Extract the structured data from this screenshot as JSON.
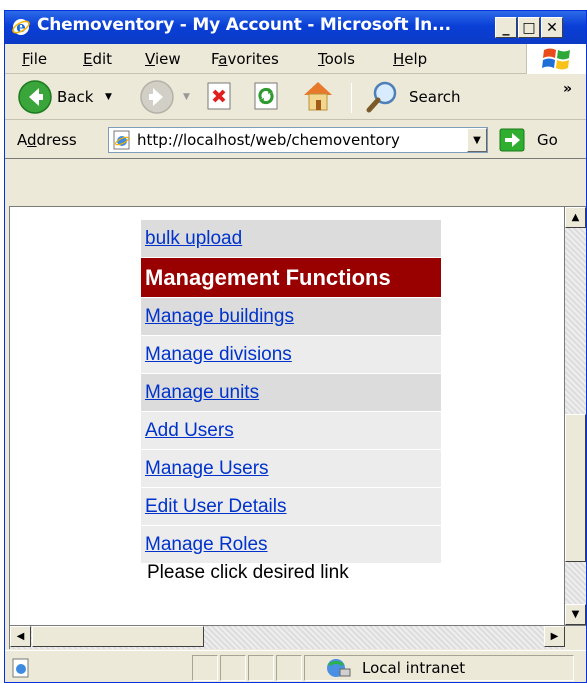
{
  "window": {
    "title": "Chemoventory - My Account - Microsoft In...",
    "minimize_label": "_",
    "maximize_label": "□",
    "close_label": "✕"
  },
  "menu": {
    "items": [
      {
        "prefix": "",
        "underline": "F",
        "rest": "ile"
      },
      {
        "prefix": "",
        "underline": "E",
        "rest": "dit"
      },
      {
        "prefix": "",
        "underline": "V",
        "rest": "iew"
      },
      {
        "prefix": "F",
        "underline": "a",
        "rest": "vorites"
      },
      {
        "prefix": "",
        "underline": "T",
        "rest": "ools"
      },
      {
        "prefix": "",
        "underline": "H",
        "rest": "elp"
      }
    ]
  },
  "toolbar": {
    "back_label": "Back",
    "search_label": "Search",
    "overflow_label": "»"
  },
  "address": {
    "label_prefix": "A",
    "label_underline": "d",
    "label_rest": "dress",
    "url": "http://localhost/web/chemoventory",
    "go_label": "Go"
  },
  "page": {
    "links_top": [
      {
        "label": "bulk upload"
      }
    ],
    "section_header": "Management Functions",
    "links": [
      {
        "label": "Manage buildings"
      },
      {
        "label": "Manage divisions"
      },
      {
        "label": "Manage units"
      },
      {
        "label": "Add Users"
      },
      {
        "label": "Manage Users"
      },
      {
        "label": "Edit User Details"
      },
      {
        "label": "Manage Roles"
      }
    ],
    "note": "Please click desired link"
  },
  "status": {
    "zone_label": "Local intranet"
  },
  "colors": {
    "header_bg": "#990000",
    "link": "#0033cc",
    "title_bar": "#0a3fd6"
  }
}
